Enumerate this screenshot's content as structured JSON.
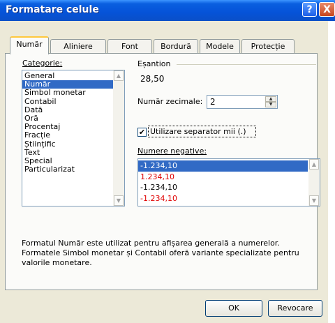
{
  "window": {
    "title": "Formatare celule"
  },
  "titlebar": {
    "help_glyph": "?",
    "close_glyph": "X"
  },
  "tabs": [
    {
      "label": "Număr"
    },
    {
      "label": "Aliniere"
    },
    {
      "label": "Font"
    },
    {
      "label": "Bordură"
    },
    {
      "label": "Modele"
    },
    {
      "label": "Protecție"
    }
  ],
  "category": {
    "label": "Categorie:",
    "items": [
      "General",
      "Număr",
      "Simbol monetar",
      "Contabil",
      "Dată",
      "Oră",
      "Procentaj",
      "Fracție",
      "Științific",
      "Text",
      "Special",
      "Particularizat"
    ],
    "selected_index": 1
  },
  "sample": {
    "label": "Eșantion",
    "value": "28,50"
  },
  "decimals": {
    "label": "Număr zecimale:",
    "value": "2"
  },
  "separator": {
    "label": "Utilizare separator mii (.)",
    "checked": true,
    "check_glyph": "✔"
  },
  "negative": {
    "label": "Numere negative:",
    "items": [
      {
        "text": "-1.234,10",
        "color": "black",
        "selected": true
      },
      {
        "text": "1.234,10",
        "color": "red"
      },
      {
        "text": "-1.234,10",
        "color": "black"
      },
      {
        "text": "-1.234,10",
        "color": "red"
      }
    ]
  },
  "description": "Formatul Număr este utilizat pentru afișarea generală a numerelor. Formatele Simbol monetar și Contabil oferă variante specializate pentru valorile monetare.",
  "buttons": {
    "ok": "OK",
    "cancel": "Revocare"
  },
  "colors": {
    "selection": "#316ac5",
    "tab_highlight": "#ffc83c",
    "dialog_bg": "#ece9d8",
    "negative_red": "#e00000"
  }
}
